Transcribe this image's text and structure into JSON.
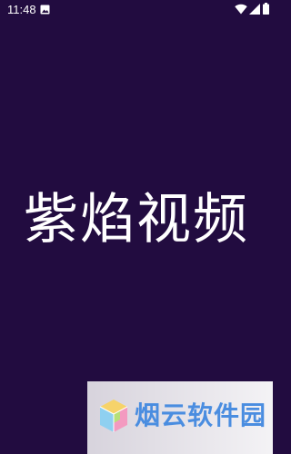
{
  "status_bar": {
    "time": "11:48",
    "icons": [
      "gallery-icon",
      "wifi-icon",
      "signal-icon",
      "battery-icon"
    ]
  },
  "splash": {
    "app_name": "紫焰视频"
  },
  "watermark": {
    "text": "烟云软件园",
    "logo_icon": "cube-logo-icon"
  },
  "colors": {
    "background": "#220c40",
    "title": "#ffffff",
    "watermark_text": "#4a8de0"
  }
}
